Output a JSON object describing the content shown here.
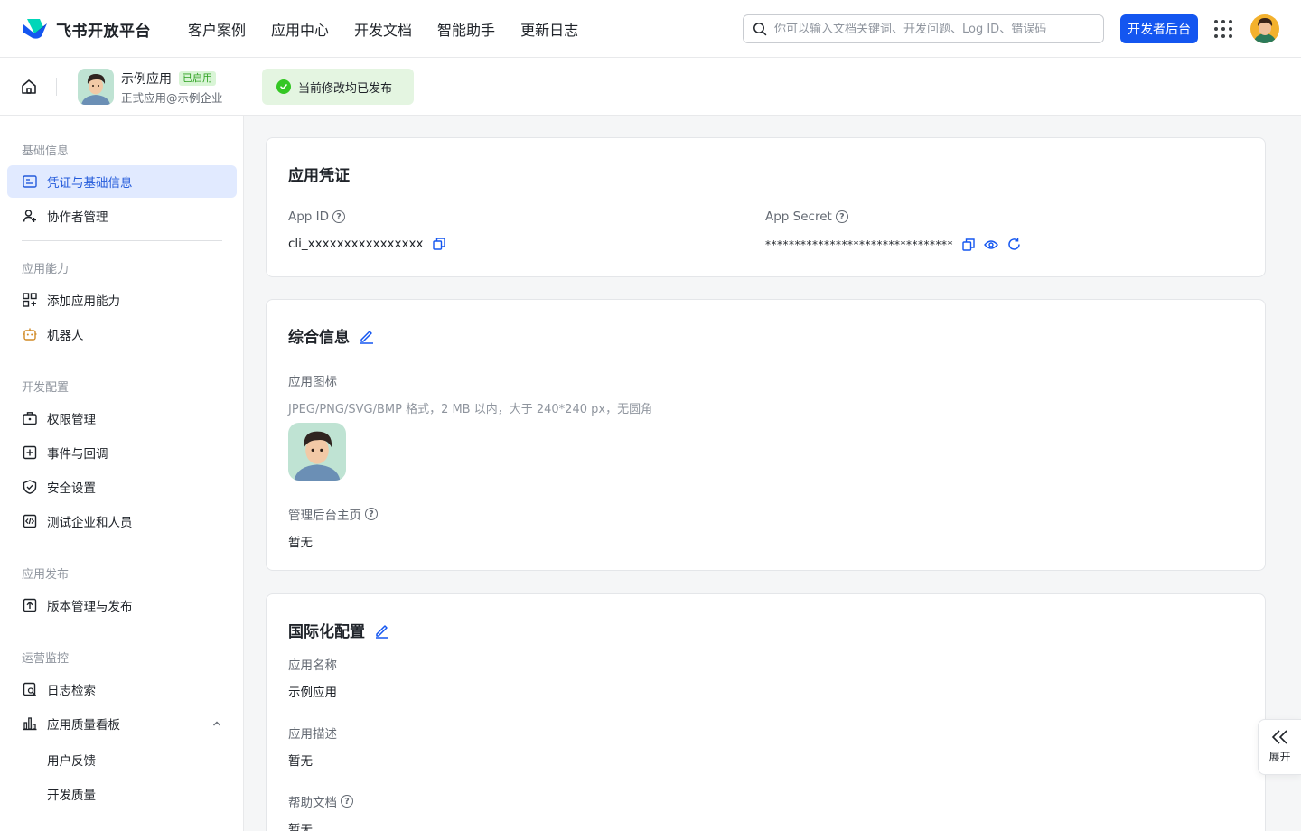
{
  "brand": {
    "name": "飞书开放平台"
  },
  "nav": {
    "links": [
      "客户案例",
      "应用中心",
      "开发文档",
      "智能助手",
      "更新日志"
    ],
    "search_placeholder": "你可以输入文档关键词、开发问题、Log ID、错误码",
    "dev_console_label": "开发者后台"
  },
  "app": {
    "name": "示例应用",
    "status_badge": "已启用",
    "subtitle": "正式应用@示例企业",
    "publish_status": "当前修改均已发布"
  },
  "sidebar": {
    "groups": [
      {
        "title": "基础信息",
        "items": [
          {
            "label": "凭证与基础信息",
            "icon": "id-card-icon",
            "active": true
          },
          {
            "label": "协作者管理",
            "icon": "user-add-icon"
          }
        ]
      },
      {
        "title": "应用能力",
        "items": [
          {
            "label": "添加应用能力",
            "icon": "apps-add-icon"
          },
          {
            "label": "机器人",
            "icon": "robot-icon"
          }
        ]
      },
      {
        "title": "开发配置",
        "items": [
          {
            "label": "权限管理",
            "icon": "briefcase-lock-icon"
          },
          {
            "label": "事件与回调",
            "icon": "event-plus-icon"
          },
          {
            "label": "安全设置",
            "icon": "shield-icon"
          },
          {
            "label": "测试企业和人员",
            "icon": "code-box-icon"
          }
        ]
      },
      {
        "title": "应用发布",
        "items": [
          {
            "label": "版本管理与发布",
            "icon": "upload-box-icon"
          }
        ]
      },
      {
        "title": "运营监控",
        "items": [
          {
            "label": "日志检索",
            "icon": "log-search-icon"
          },
          {
            "label": "应用质量看板",
            "icon": "bar-chart-icon",
            "expanded": true,
            "children": [
              "用户反馈",
              "开发质量"
            ]
          }
        ]
      }
    ]
  },
  "credentials": {
    "title": "应用凭证",
    "app_id_label": "App ID",
    "app_id_value": "cli_xxxxxxxxxxxxxxxx",
    "app_secret_label": "App Secret",
    "app_secret_value": "********************************"
  },
  "general": {
    "title": "综合信息",
    "icon_label": "应用图标",
    "icon_hint": "JPEG/PNG/SVG/BMP 格式，2 MB 以内，大于 240*240 px，无圆角",
    "admin_home_label": "管理后台主页",
    "admin_home_value": "暂无"
  },
  "i18n": {
    "title": "国际化配置",
    "name_label": "应用名称",
    "name_value": "示例应用",
    "desc_label": "应用描述",
    "desc_value": "暂无",
    "help_label": "帮助文档",
    "help_value": "暂无"
  },
  "expand": {
    "label": "展开"
  },
  "colors": {
    "primary": "#1456f0",
    "active_bg": "#e1eaff",
    "success": "#34c724"
  }
}
